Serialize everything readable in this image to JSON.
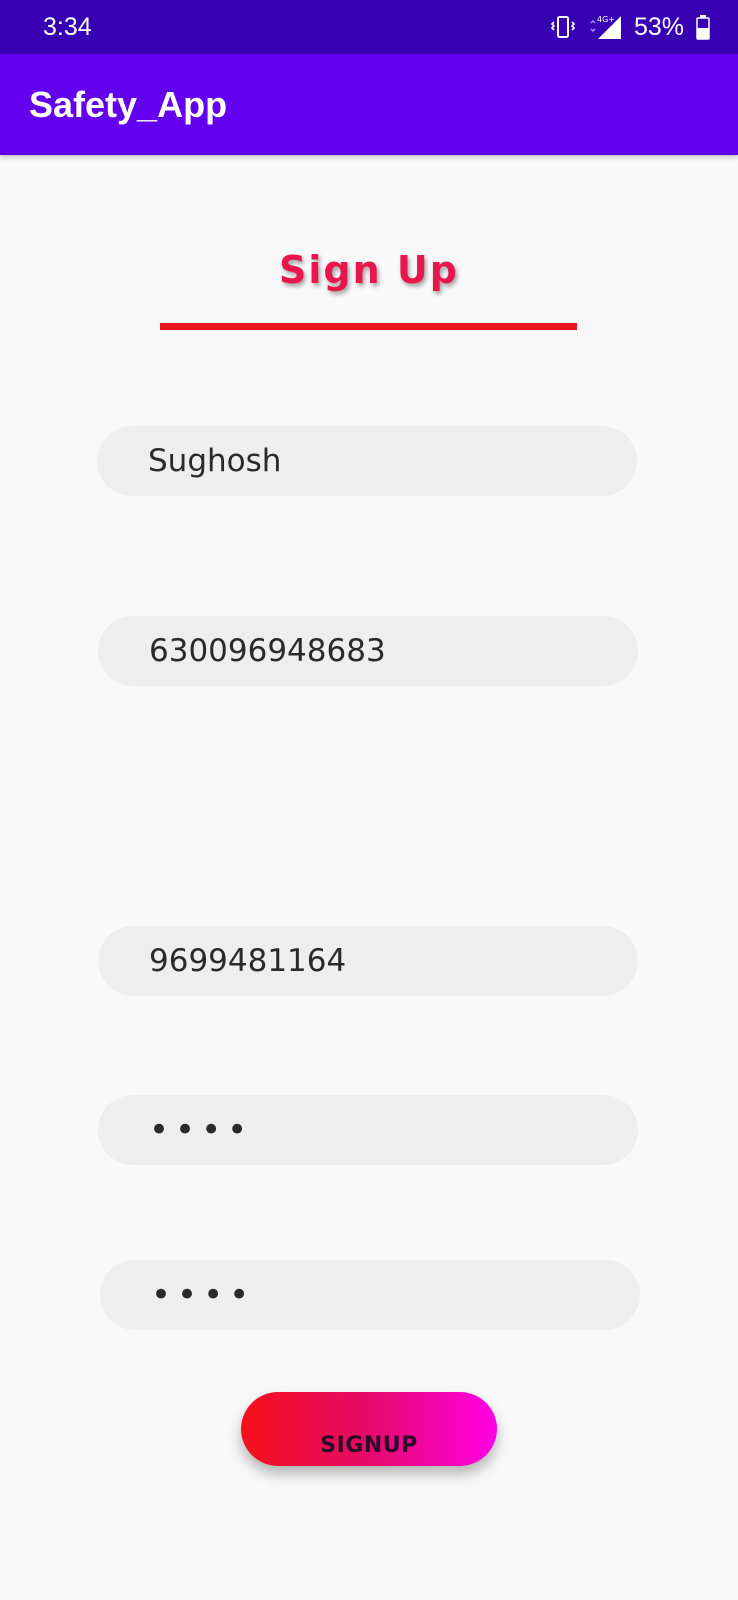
{
  "status_bar": {
    "time": "3:34",
    "network": "4G+",
    "battery_percent": "53%",
    "icons": [
      "vibrate-icon",
      "signal-icon",
      "battery-icon"
    ],
    "battery_level": 0.53
  },
  "app_bar": {
    "title": "Safety_App",
    "color": "#6200ee"
  },
  "form": {
    "heading": "Sign Up",
    "fields": [
      {
        "value": "Sughosh",
        "type": "text"
      },
      {
        "value": "630096948683",
        "type": "text"
      },
      {
        "value": "9699481164",
        "type": "text"
      },
      {
        "value": "••••",
        "type": "password"
      },
      {
        "value": "••••",
        "type": "password"
      }
    ],
    "submit_label": "SIGNUP"
  },
  "colors": {
    "status_bar": "#3700b3",
    "accent_red": "#e8164c",
    "underline": "#e8141e",
    "button_gradient_start": "#f5101a",
    "button_gradient_end": "#ff00e6"
  }
}
